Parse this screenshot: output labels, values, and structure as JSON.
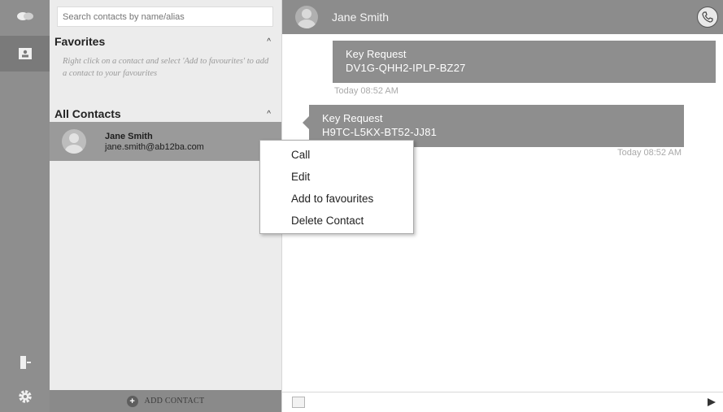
{
  "search": {
    "placeholder": "Search contacts by name/alias"
  },
  "favorites": {
    "title": "Favorites",
    "caret": "^",
    "hint": "Right click on a contact and select 'Add to favourites' to add a contact to your favourites"
  },
  "all_contacts": {
    "title": "All Contacts",
    "caret": "^",
    "items": [
      {
        "name": "Jane Smith",
        "email": "jane.smith@ab12ba.com"
      }
    ]
  },
  "add_contact": {
    "label": "ADD CONTACT",
    "icon": "+"
  },
  "chat": {
    "title": "Jane Smith",
    "messages": [
      {
        "title": "Key Request",
        "code": "DV1G-QHH2-IPLP-BZ27",
        "time": "Today 08:52 AM"
      },
      {
        "title": "Key Request",
        "code": "H9TC-L5KX-BT52-JJ81",
        "time": "Today 08:52 AM"
      }
    ]
  },
  "context_menu": {
    "items": [
      {
        "label": "Call"
      },
      {
        "label": "Edit"
      },
      {
        "label": "Add to favourites"
      },
      {
        "label": "Delete Contact"
      }
    ]
  },
  "colors": {
    "rail": "#8e8e8e",
    "header": "#8c8c8c",
    "bubble": "#8e8e8e",
    "selected_contact": "#9a9a9a",
    "panel": "#ececec"
  },
  "icons": {
    "rail_top": "chat-bubbles-icon",
    "rail_contacts": "contacts-card-icon",
    "rail_exit": "logout-icon",
    "rail_settings": "gear-icon",
    "call": "phone-icon",
    "attach": "image-icon",
    "send": "send-arrow-icon"
  }
}
